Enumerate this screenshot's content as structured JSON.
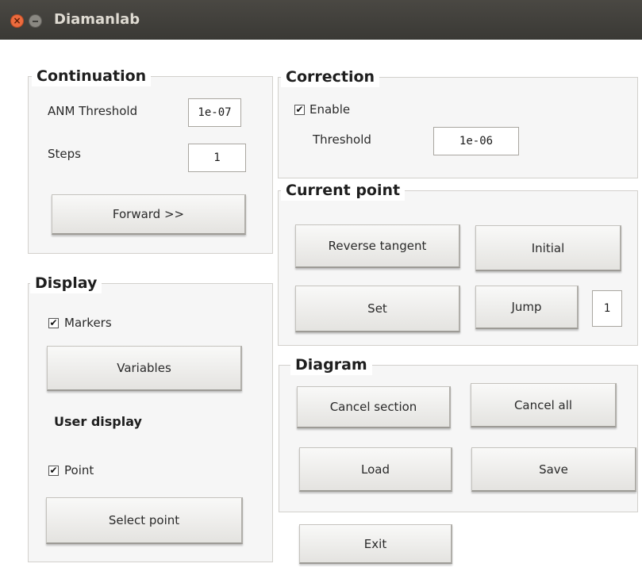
{
  "window": {
    "title": "Diamanlab",
    "close_glyph": "×"
  },
  "continuation": {
    "legend": "Continuation",
    "anm_threshold_label": "ANM Threshold",
    "anm_threshold_value": "1e-07",
    "steps_label": "Steps",
    "steps_value": "1",
    "forward_label": "Forward  >>"
  },
  "correction": {
    "legend": "Correction",
    "enable_label": "Enable",
    "enable_checked": true,
    "threshold_label": "Threshold",
    "threshold_value": "1e-06"
  },
  "current_point": {
    "legend": "Current point",
    "reverse_tangent_label": "Reverse tangent",
    "initial_label": "Initial",
    "set_label": "Set",
    "jump_label": "Jump",
    "jump_value": "1"
  },
  "display": {
    "legend": "Display",
    "markers_label": "Markers",
    "markers_checked": true,
    "variables_label": "Variables",
    "user_display_label": "User display",
    "point_label": "Point",
    "point_checked": true,
    "select_point_label": "Select point"
  },
  "diagram": {
    "legend": "Diagram",
    "cancel_section_label": "Cancel section",
    "cancel_all_label": "Cancel all",
    "load_label": "Load",
    "save_label": "Save"
  },
  "exit_label": "Exit",
  "check_glyph": "✔"
}
